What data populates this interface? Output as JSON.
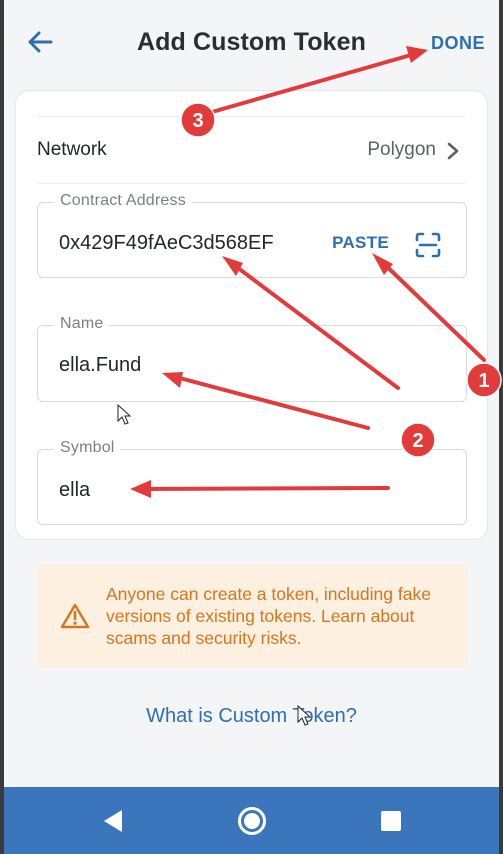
{
  "header": {
    "title": "Add Custom Token",
    "done_label": "DONE"
  },
  "network": {
    "label": "Network",
    "value": "Polygon"
  },
  "contract": {
    "label": "Contract Address",
    "value": "0x429F49fAeC3d568EF",
    "paste_label": "PASTE"
  },
  "name_field": {
    "label": "Name",
    "value": "ella.Fund"
  },
  "symbol_field": {
    "label": "Symbol",
    "value": "ella"
  },
  "warning": {
    "text": "Anyone can create a token, including fake versions of existing tokens. Learn about scams and security risks."
  },
  "help_link": "What is Custom Token?",
  "annotations": {
    "badges": [
      "1",
      "2",
      "3"
    ],
    "color": "#e23b3b"
  },
  "colors": {
    "accent": "#2f6fb1",
    "nav_bar": "#3b76bd",
    "warning_bg": "#fdf0e0",
    "warning_text": "#d4761f"
  },
  "icons": [
    "back-arrow-icon",
    "chevron-right-icon",
    "scan-qr-icon",
    "warning-triangle-icon",
    "nav-back-icon",
    "nav-home-icon",
    "nav-recents-icon"
  ]
}
